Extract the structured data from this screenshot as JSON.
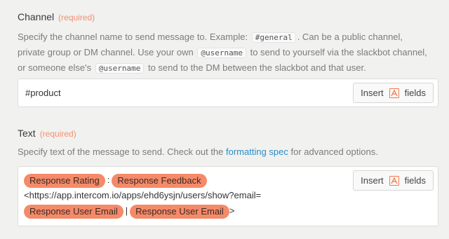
{
  "channel": {
    "label": "Channel",
    "required": "(required)",
    "help": {
      "p1": "Specify the channel name to send message to. Example:",
      "code1": "#general",
      "p2": ". Can be a public channel, private group or DM channel. Use your own",
      "code2": "@username",
      "p3": "to send to yourself via the slackbot channel, or someone else's",
      "code3": "@username",
      "p4": "to send to the DM between the slackbot and that user."
    },
    "value": "#product",
    "insert_label": "Insert",
    "fields_label": "fields"
  },
  "text": {
    "label": "Text",
    "required": "(required)",
    "help": {
      "p1": "Specify text of the message to send. Check out the",
      "link": "formatting spec",
      "p2": "for advanced options."
    },
    "pills": [
      "Response Rating",
      "Response Feedback",
      "Response User Email",
      "Response User Email"
    ],
    "sep1": ":",
    "url_text": "<https://app.intercom.io/apps/ehd6ysjn/users/show?email=",
    "sep2": "|",
    "tail": ">",
    "insert_label": "Insert",
    "fields_label": "fields"
  },
  "colors": {
    "accent": "#f58a69",
    "required": "#f28f6d",
    "link": "#2a8ec5"
  }
}
